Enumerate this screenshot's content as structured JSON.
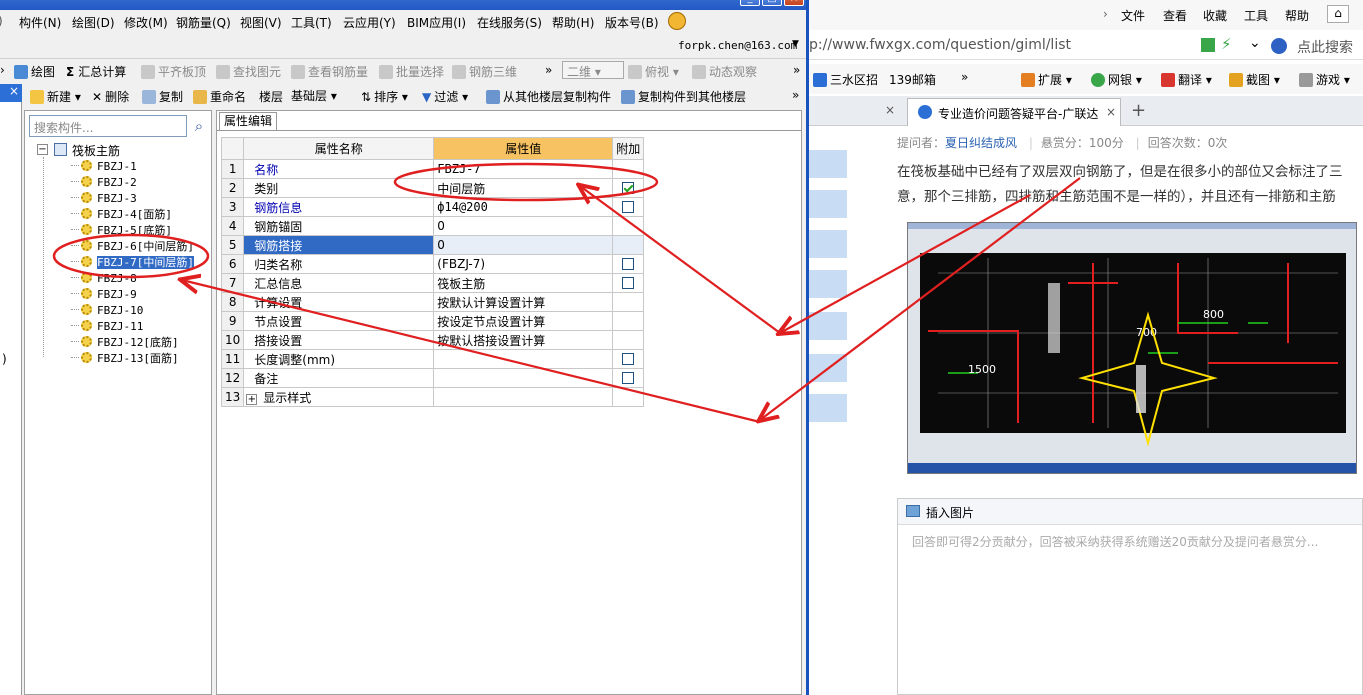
{
  "app": {
    "menu": [
      "构件(N)",
      "绘图(D)",
      "修改(M)",
      "钢筋量(Q)",
      "视图(V)",
      "工具(T)",
      "云应用(Y)",
      "BIM应用(I)",
      "在线服务(S)",
      "帮助(H)",
      "版本号(B)"
    ],
    "user_email": "forpk.chen@163.com",
    "toolbar1": [
      {
        "label": "绘图",
        "enabled": true
      },
      {
        "label": "汇总计算",
        "enabled": true
      },
      {
        "label": "平齐板顶",
        "enabled": false
      },
      {
        "label": "查找图元",
        "enabled": false
      },
      {
        "label": "查看钢筋量",
        "enabled": false
      },
      {
        "label": "批量选择",
        "enabled": false
      },
      {
        "label": "钢筋三维",
        "enabled": false
      },
      {
        "label": "二维",
        "enabled": false
      },
      {
        "label": "俯视",
        "enabled": false
      },
      {
        "label": "动态观察",
        "enabled": false
      }
    ],
    "compbar": {
      "new": "新建",
      "delete": "删除",
      "copy": "复制",
      "rename": "重命名",
      "floor_label": "楼层",
      "floor_value": "基础层",
      "sort": "排序",
      "filter": "过滤",
      "copy_from": "从其他楼层复制构件",
      "copy_to": "复制构件到其他楼层"
    },
    "search_placeholder": "搜索构件...",
    "tree": {
      "root": "筏板主筋",
      "items": [
        "FBZJ-1",
        "FBZJ-2",
        "FBZJ-3",
        "FBZJ-4[面筋]",
        "FBZJ-5[底筋]",
        "FBZJ-6[中间层筋]",
        "FBZJ-7[中间层筋]",
        "FBZJ-8",
        "FBZJ-9",
        "FBZJ-10",
        "FBZJ-11",
        "FBZJ-12[底筋]",
        "FBZJ-13[面筋]"
      ],
      "selected_index": 6
    },
    "props": {
      "tab": "属性编辑",
      "headers": {
        "name": "属性名称",
        "value": "属性值",
        "extra": "附加"
      },
      "rows": [
        {
          "n": "1",
          "name": "名称",
          "value": "FBZJ-7",
          "check": null,
          "blue": true
        },
        {
          "n": "2",
          "name": "类别",
          "value": "中间层筋",
          "check": true,
          "blue": false
        },
        {
          "n": "3",
          "name": "钢筋信息",
          "value": "ф14@200",
          "check": false,
          "blue": true
        },
        {
          "n": "4",
          "name": "钢筋锚固",
          "value": "0",
          "check": null,
          "blue": false
        },
        {
          "n": "5",
          "name": "钢筋搭接",
          "value": "0",
          "check": null,
          "blue": false,
          "selected": true
        },
        {
          "n": "6",
          "name": "归类名称",
          "value": "(FBZJ-7)",
          "check": false,
          "blue": false
        },
        {
          "n": "7",
          "name": "汇总信息",
          "value": "筏板主筋",
          "check": false,
          "blue": false
        },
        {
          "n": "8",
          "name": "计算设置",
          "value": "按默认计算设置计算",
          "check": null,
          "blue": false
        },
        {
          "n": "9",
          "name": "节点设置",
          "value": "按设定节点设置计算",
          "check": null,
          "blue": false
        },
        {
          "n": "10",
          "name": "搭接设置",
          "value": "按默认搭接设置计算",
          "check": null,
          "blue": false
        },
        {
          "n": "11",
          "name": "长度调整(mm)",
          "value": "",
          "check": false,
          "blue": false
        },
        {
          "n": "12",
          "name": "备注",
          "value": "",
          "check": false,
          "blue": false
        },
        {
          "n": "13",
          "name": "显示样式",
          "value": "",
          "check": null,
          "blue": false,
          "expand": true
        }
      ]
    }
  },
  "browser": {
    "menu": [
      "文件",
      "查看",
      "收藏",
      "工具",
      "帮助"
    ],
    "url": "p://www.fwxgx.com/question/giml/list",
    "search_placeholder": "点此搜索",
    "favorites": [
      "三水区招",
      "139邮箱",
      "扩展",
      "网银",
      "翻译",
      "截图",
      "游戏"
    ],
    "tab_title": "专业造价问题答疑平台-广联达",
    "asker_label": "提问者：",
    "asker_name": "夏日纠结成风",
    "reward": "悬赏分：100分",
    "answers": "回答次数：0次",
    "question_line1": "在筏板基础中已经有了双层双向钢筋了，但是在很多小的部位又会标注了三",
    "question_line2": "意，那个三排筋，四排筋和主筋范围不是一样的），并且还有一排筋和主筋",
    "insert_image": "插入图片",
    "answer_placeholder": "回答即可得2分贡献分，回答被采纳获得系统赠送20贡献分及提问者悬赏分..."
  },
  "colors": {
    "selection": "#316ac5",
    "value_header": "#f6c262",
    "annotation": "#e02020",
    "divider": "#1a52c0"
  }
}
